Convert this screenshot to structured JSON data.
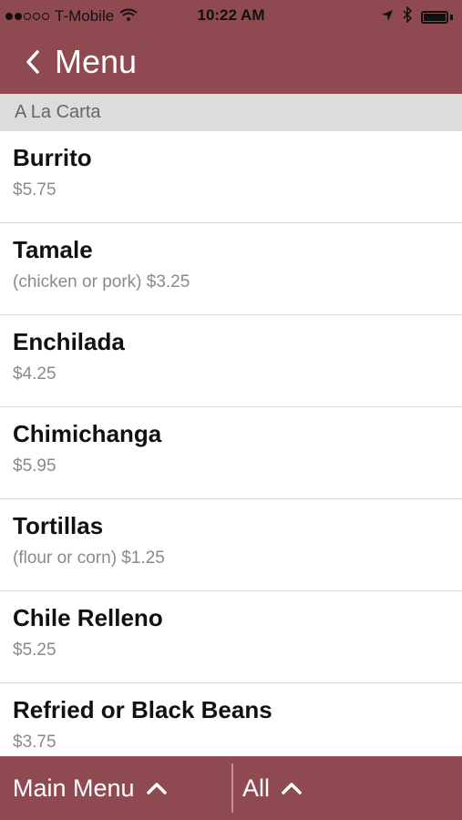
{
  "status_bar": {
    "carrier": "T-Mobile",
    "time": "10:22 AM"
  },
  "nav": {
    "title": "Menu",
    "back_icon": "chevron-left-icon"
  },
  "section": {
    "title": "A La Carta"
  },
  "items": [
    {
      "name": "Burrito",
      "description": "$5.75"
    },
    {
      "name": "Tamale",
      "description": "(chicken or pork) $3.25"
    },
    {
      "name": "Enchilada",
      "description": "$4.25"
    },
    {
      "name": "Chimichanga",
      "description": "$5.95"
    },
    {
      "name": "Tortillas",
      "description": "(flour or corn) $1.25"
    },
    {
      "name": "Chile Relleno",
      "description": "$5.25"
    },
    {
      "name": "Refried or Black Beans",
      "description": "$3.75"
    }
  ],
  "tab_bar": {
    "main_label": "Main Menu",
    "all_label": "All"
  },
  "colors": {
    "brand": "#8f4951",
    "section_bg": "#dcdcdc"
  }
}
